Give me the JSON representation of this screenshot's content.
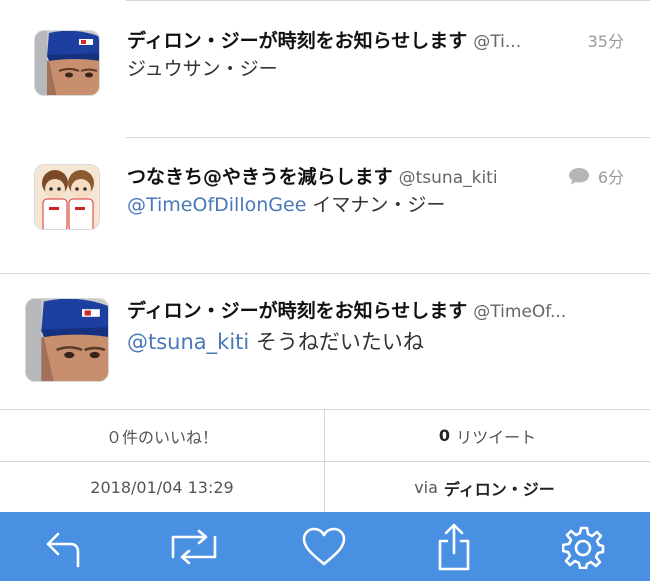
{
  "tweets": [
    {
      "name": "ディロン・ジーが時刻をお知らせします",
      "handle": "@Ti...",
      "time": "35分",
      "text": "ジュウサン・ジー",
      "mention": ""
    },
    {
      "name": "つなきち@やきうを減らします",
      "handle": "@tsuna_kiti",
      "time": "6分",
      "mention": "@TimeOfDillonGee",
      "text": " イマナン・ジー"
    },
    {
      "name": "ディロン・ジーが時刻をお知らせします",
      "handle": "@TimeOf...",
      "mention": "@tsuna_kiti",
      "text": " そうねだいたいね"
    }
  ],
  "stats": {
    "likes_label": "０件のいいね！",
    "retweet_count": "0",
    "retweet_label": "リツイート",
    "timestamp": "2018/01/04 13:29",
    "via_prefix": "via",
    "via_source": "ディロン・ジー"
  },
  "toolbar": {
    "icons": [
      "reply-icon",
      "retweet-icon",
      "like-icon",
      "share-icon",
      "settings-icon"
    ]
  },
  "colors": {
    "accent": "#4a90e2",
    "mention": "#4a78b8",
    "divider": "#d6d6d6"
  }
}
